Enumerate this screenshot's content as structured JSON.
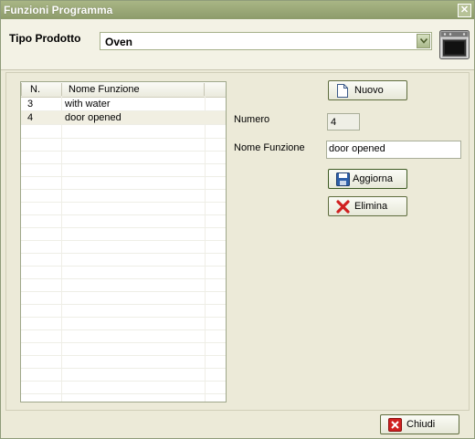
{
  "window": {
    "title": "Funzioni Programma",
    "close_glyph": "✕"
  },
  "tipo_prodotto": {
    "label": "Tipo Prodotto",
    "value": "Oven",
    "icon": "oven-icon"
  },
  "grid": {
    "headers": [
      "N.",
      "Nome Funzione"
    ],
    "rows": [
      {
        "n": "3",
        "name": "with water"
      },
      {
        "n": "4",
        "name": "door opened",
        "selected": true
      }
    ]
  },
  "buttons": {
    "new": "Nuovo",
    "update": "Aggiorna",
    "delete": "Elimina",
    "close": "Chiudi"
  },
  "form": {
    "numero_label": "Numero",
    "numero_value": "4",
    "nome_label": "Nome Funzione",
    "nome_value": "door opened"
  },
  "colors": {
    "titlebar": "#9aa878",
    "window_bg": "#ecead8",
    "selected_row": "#f1efe2",
    "delete_red": "#d02020",
    "save_blue": "#2e5fa8"
  }
}
